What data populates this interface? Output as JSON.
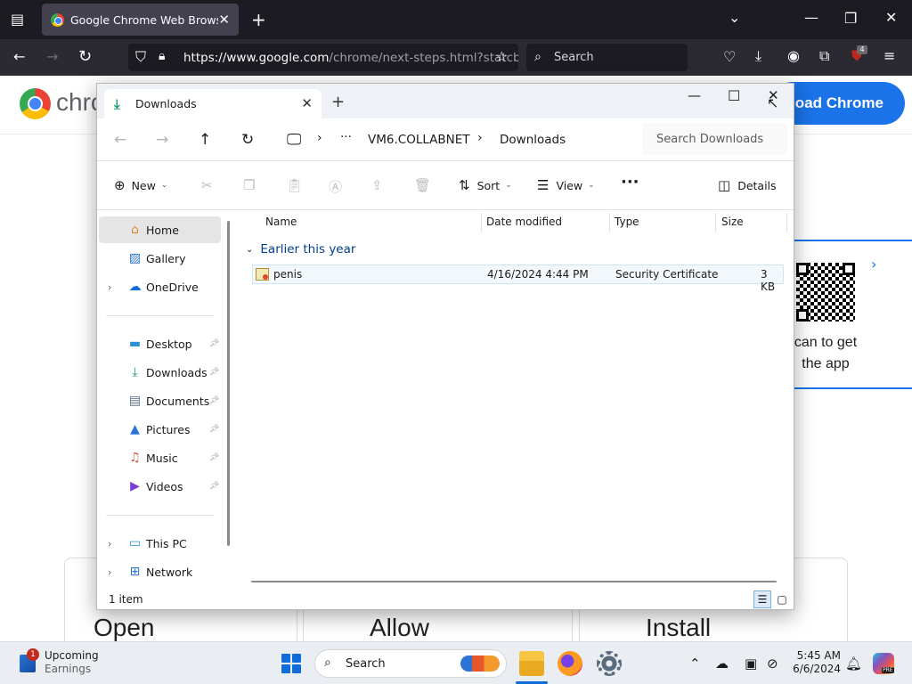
{
  "firefox": {
    "tab_title": "Google Chrome Web Browser",
    "url_domain": "https://www.google.com",
    "url_path": "/chrome/next-steps.html?statcb",
    "search_placeholder": "Search",
    "ublock_count": "4"
  },
  "page": {
    "brand_partial": "chro",
    "download_button": "nload Chrome",
    "qr_text_line1": "can to get",
    "qr_text_line2": "the app",
    "steps": [
      "Open",
      "Allow",
      "Install"
    ]
  },
  "explorer": {
    "tab_title": "Downloads",
    "breadcrumbs": [
      "VM6.COLLABNET",
      "Downloads"
    ],
    "search_placeholder": "Search Downloads",
    "toolbar": {
      "new_label": "New",
      "sort_label": "Sort",
      "view_label": "View",
      "details_label": "Details"
    },
    "nav": {
      "home": "Home",
      "gallery": "Gallery",
      "onedrive": "OneDrive",
      "desktop": "Desktop",
      "downloads": "Downloads",
      "documents": "Documents",
      "pictures": "Pictures",
      "music": "Music",
      "videos": "Videos",
      "thispc": "This PC",
      "network": "Network"
    },
    "columns": {
      "name": "Name",
      "date": "Date modified",
      "type": "Type",
      "size": "Size"
    },
    "group_label": "Earlier this year",
    "files": [
      {
        "name": "penis",
        "date": "4/16/2024 4:44 PM",
        "type": "Security Certificate",
        "size": "3 KB"
      }
    ],
    "status": "1 item"
  },
  "taskbar": {
    "widget_badge": "1",
    "widget_title": "Upcoming",
    "widget_sub": "Earnings",
    "search_label": "Search",
    "time": "5:45 AM",
    "date": "6/6/2024",
    "copilot_badge": "PRE"
  }
}
